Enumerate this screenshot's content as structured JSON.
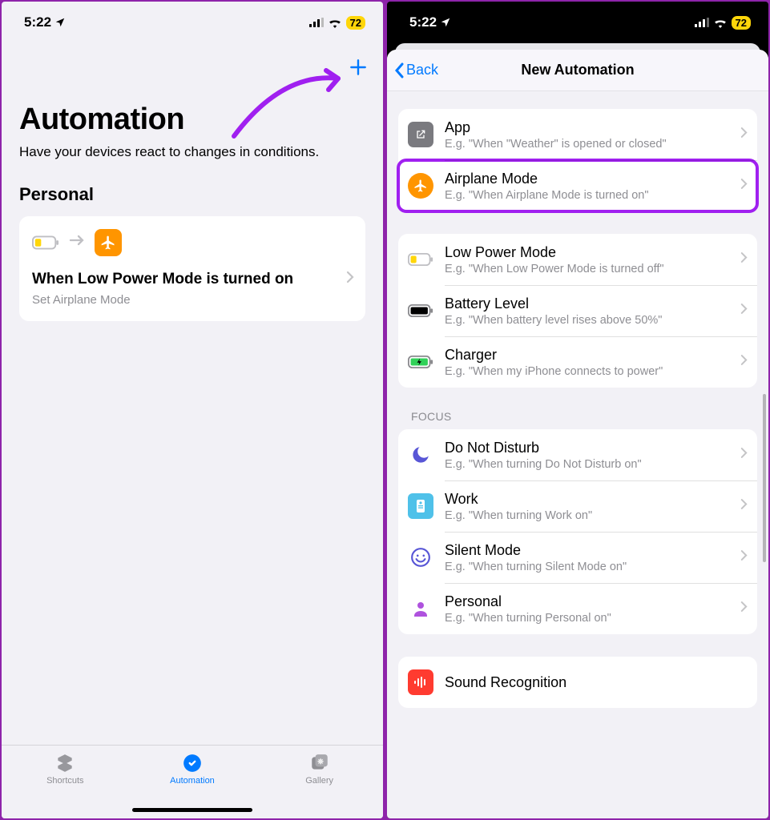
{
  "status": {
    "time": "5:22",
    "battery": "72"
  },
  "left": {
    "title": "Automation",
    "subtitle": "Have your devices react to changes in conditions.",
    "section": "Personal",
    "card": {
      "title": "When Low Power Mode is turned on",
      "subtitle": "Set Airplane Mode"
    },
    "tabs": {
      "shortcuts": "Shortcuts",
      "automation": "Automation",
      "gallery": "Gallery"
    }
  },
  "right": {
    "back": "Back",
    "title": "New Automation",
    "group1": [
      {
        "title": "App",
        "sub": "E.g. \"When \"Weather\" is opened or closed\""
      },
      {
        "title": "Airplane Mode",
        "sub": "E.g. \"When Airplane Mode is turned on\""
      }
    ],
    "group2": [
      {
        "title": "Low Power Mode",
        "sub": "E.g. \"When Low Power Mode is turned off\""
      },
      {
        "title": "Battery Level",
        "sub": "E.g. \"When battery level rises above 50%\""
      },
      {
        "title": "Charger",
        "sub": "E.g. \"When my iPhone connects to power\""
      }
    ],
    "focus_label": "FOCUS",
    "group3": [
      {
        "title": "Do Not Disturb",
        "sub": "E.g. \"When turning Do Not Disturb on\""
      },
      {
        "title": "Work",
        "sub": "E.g. \"When turning Work on\""
      },
      {
        "title": "Silent Mode",
        "sub": "E.g. \"When turning Silent Mode  on\""
      },
      {
        "title": "Personal",
        "sub": "E.g. \"When turning Personal on\""
      }
    ],
    "group4": [
      {
        "title": "Sound Recognition",
        "sub": ""
      }
    ]
  }
}
